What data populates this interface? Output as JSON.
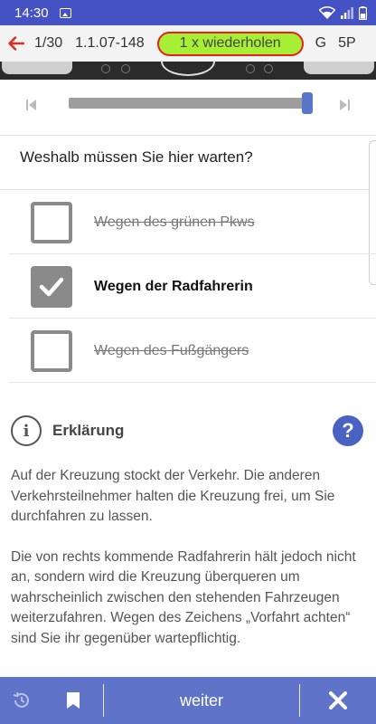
{
  "status_bar": {
    "time": "14:30"
  },
  "app_bar": {
    "counter": "1/30",
    "question_code": "1.1.07-148",
    "repeat_label": "1 x wiederholen",
    "license_class": "G",
    "points": "5P"
  },
  "question": {
    "text": "Weshalb müssen Sie hier warten?"
  },
  "answers": [
    {
      "text": "Wegen des grünen Pkws",
      "checked": false
    },
    {
      "text": "Wegen der Radfahrerin",
      "checked": true
    },
    {
      "text": "Wegen des Fußgängers",
      "checked": false
    }
  ],
  "explanation": {
    "title": "Erklärung",
    "paragraphs": [
      "Auf der Kreuzung stockt der Verkehr. Die anderen Verkehrsteilnehmer halten die Kreuzung frei, um Sie durchfahren zu lassen.",
      "Die von rechts kommende Radfahrerin hält jedoch nicht an, sondern wird die Kreuzung überqueren um wahrscheinlich zwischen den stehenden Fahrzeugen weiterzufahren. Wegen des Zeichens „Vorfahrt achten“ sind Sie ihr gegenüber wartepflichtig."
    ]
  },
  "bottom_bar": {
    "next_label": "weiter"
  },
  "colors": {
    "status_bar": "#4452c4",
    "bottom_bar": "#5f73c8",
    "repeat_pill_fill": "#a6ef35",
    "repeat_pill_border": "#e52118",
    "slider_thumb": "#5a76c8"
  },
  "icons": {
    "back": "arrow-left-icon",
    "skip_prev": "skip-previous-icon",
    "skip_next": "skip-next-icon",
    "info": "info-icon",
    "help": "help-icon",
    "history": "history-icon",
    "bookmark": "bookmark-icon",
    "close": "close-icon"
  },
  "video_progress": 1.0
}
